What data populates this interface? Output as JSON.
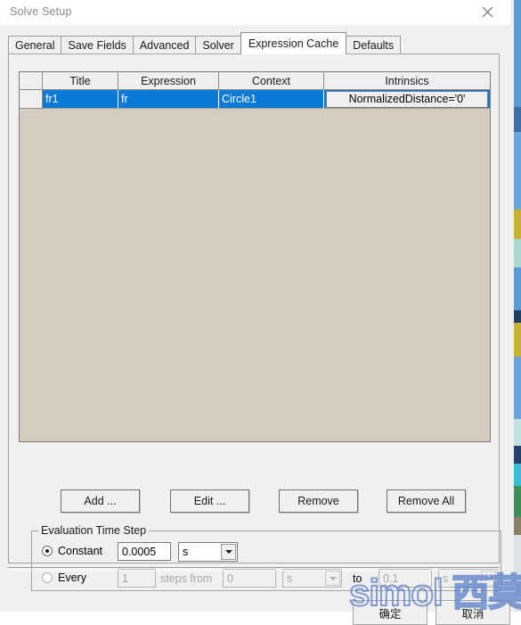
{
  "window": {
    "title": "Solve Setup",
    "close_icon": "close-icon"
  },
  "tabs": [
    {
      "label": "General",
      "selected": false
    },
    {
      "label": "Save Fields",
      "selected": false
    },
    {
      "label": "Advanced",
      "selected": false
    },
    {
      "label": "Solver",
      "selected": false
    },
    {
      "label": "Expression Cache",
      "selected": true
    },
    {
      "label": "Defaults",
      "selected": false
    }
  ],
  "grid": {
    "columns": [
      "Title",
      "Expression",
      "Context",
      "Intrinsics"
    ],
    "rows": [
      {
        "title": "fr1",
        "expression": "fr",
        "context": "Circle1",
        "intrinsics": "NormalizedDistance='0'",
        "selected": true
      }
    ]
  },
  "list_buttons": {
    "add": "Add ...",
    "edit": "Edit ...",
    "remove": "Remove",
    "remove_all": "Remove All"
  },
  "evaluation_time_step": {
    "group_label": "Evaluation Time Step",
    "constant": {
      "label": "Constant",
      "selected": true,
      "value": "0.0005",
      "unit": "s"
    },
    "every": {
      "label": "Every",
      "selected": false,
      "steps_value": "1",
      "steps_from_label": "steps from",
      "from_value": "0",
      "from_unit": "s",
      "to_label": "to",
      "to_value": "0.1",
      "to_unit": "s"
    }
  },
  "dialog_buttons": {
    "ok": "确定",
    "cancel": "取消"
  },
  "watermark": {
    "text": "simol 西莫",
    "color": "#5b7fc7"
  },
  "colors": {
    "selection_blue": "#0a7ad8",
    "grid_background": "#d4ccbc",
    "dialog_background": "#f0f0f0",
    "titlebar_background": "#ffffff",
    "title_text": "#8a8a8a"
  }
}
